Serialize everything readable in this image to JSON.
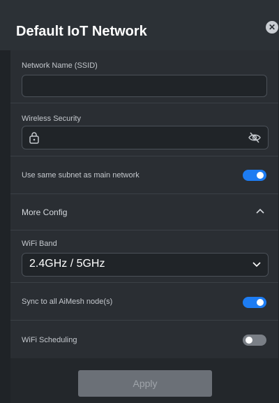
{
  "dialog": {
    "title": "Default IoT Network",
    "close_icon": "close-icon"
  },
  "fields": {
    "ssid": {
      "label": "Network Name (SSID)",
      "value": "",
      "placeholder": ""
    },
    "wireless_security": {
      "label": "Wireless Security",
      "value": "",
      "lock_icon": "lock-icon",
      "visibility_icon": "eye-slash-icon"
    }
  },
  "toggles": {
    "same_subnet": {
      "label": "Use same subnet as main network",
      "state": "on"
    },
    "sync_aimesh": {
      "label": "Sync to all AiMesh node(s)",
      "state": "on"
    },
    "wifi_scheduling": {
      "label": "WiFi Scheduling",
      "state": "off"
    }
  },
  "more_config": {
    "label": "More Config",
    "expanded": true
  },
  "wifi_band": {
    "label": "WiFi Band",
    "selected": "2.4GHz / 5GHz"
  },
  "footer": {
    "apply_label": "Apply"
  },
  "colors": {
    "accent": "#1d7cf2",
    "panel": "#2a2e33",
    "text": "#ffffff"
  }
}
